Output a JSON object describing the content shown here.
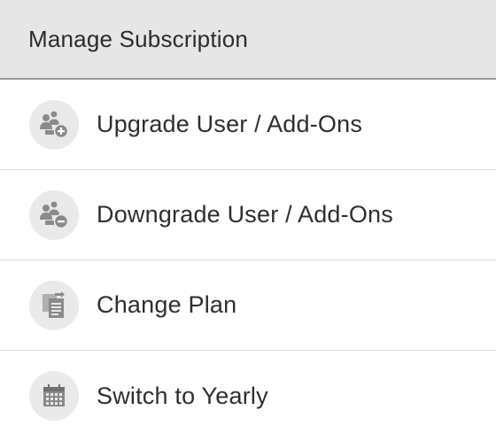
{
  "header": {
    "title": "Manage Subscription"
  },
  "menu": {
    "items": [
      {
        "label": "Upgrade User / Add-Ons",
        "icon": "user-add-icon"
      },
      {
        "label": "Downgrade User / Add-Ons",
        "icon": "user-remove-icon"
      },
      {
        "label": "Change Plan",
        "icon": "change-plan-icon"
      },
      {
        "label": "Switch to Yearly",
        "icon": "calendar-icon"
      }
    ]
  },
  "colors": {
    "header_bg": "#e6e6e6",
    "icon_bg": "#e9e9e9",
    "icon_fg": "#8a8a8a",
    "text": "#2e2e2e"
  }
}
